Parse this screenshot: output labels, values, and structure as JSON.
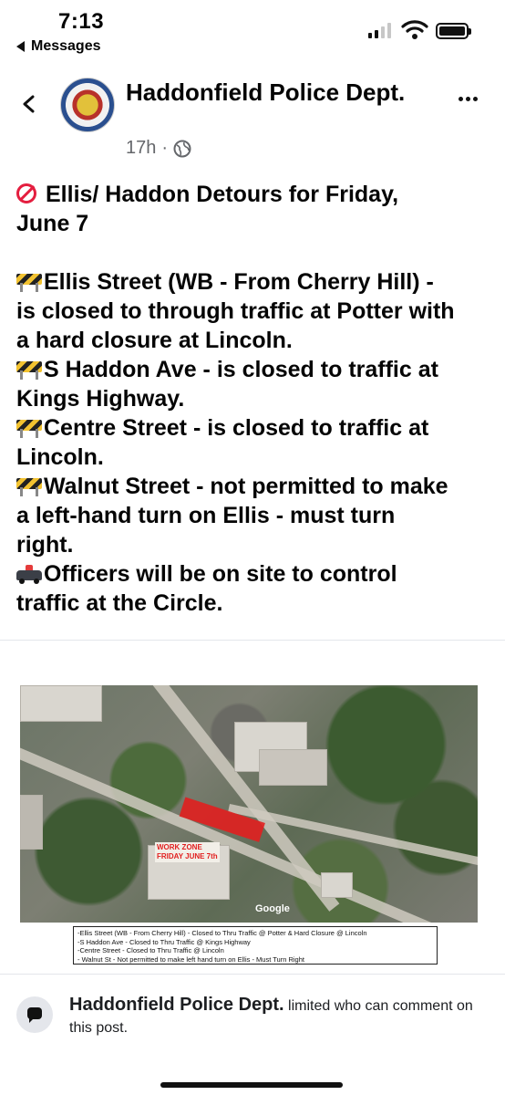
{
  "status_bar": {
    "time": "7:13",
    "back_app": "Messages"
  },
  "header": {
    "page_name": "Haddonfield Police Dept.",
    "timestamp": "17h",
    "separator": "·",
    "audience_icon": "globe-icon",
    "back_icon": "chevron-left-icon",
    "more_icon": "more-dots-icon"
  },
  "post": {
    "lines": [
      {
        "icon": "no-entry-icon",
        "text": "Ellis/ Haddon Detours for Friday,"
      },
      {
        "icon": "",
        "text": "June 7"
      },
      {
        "icon": "construction-barrier-icon",
        "text": "Ellis Street (WB - From Cherry Hill) -"
      },
      {
        "icon": "",
        "text": "is closed to through traffic at Potter with"
      },
      {
        "icon": "",
        "text": "a hard closure at Lincoln."
      },
      {
        "icon": "construction-barrier-icon",
        "text": "S Haddon Ave - is closed to traffic at"
      },
      {
        "icon": "",
        "text": "Kings Highway."
      },
      {
        "icon": "construction-barrier-icon",
        "text": "Centre Street - is closed to traffic at"
      },
      {
        "icon": "",
        "text": "Lincoln."
      },
      {
        "icon": "construction-barrier-icon",
        "text": "Walnut Street - not permitted to make"
      },
      {
        "icon": "",
        "text": "a left-hand turn on Ellis - must turn"
      },
      {
        "icon": "",
        "text": "right."
      },
      {
        "icon": "police-car-icon",
        "text": "Officers will be on site to control"
      },
      {
        "icon": "",
        "text": "traffic at the Circle."
      }
    ]
  },
  "image": {
    "work_zone_label_1": "WORK ZONE",
    "work_zone_label_2": "FRIDAY JUNE 7th",
    "map_credit": "Google",
    "legend": [
      "-Ellis Street (WB - From Cherry Hill) - Closed to Thru Traffic @ Potter & Hard Closure @ Lincoln",
      "-S Haddon Ave - Closed to Thru Traffic @ Kings Highway",
      "-Centre Street - Closed to Thru Traffic @ Lincoln",
      "- Walnut St - Not permitted to make left hand turn on Ellis - Must Turn Right"
    ]
  },
  "footer": {
    "name": "Haddonfield Police Dept.",
    "message": "limited who can comment on this post.",
    "icon": "comment-icon"
  },
  "colors": {
    "text": "#050505",
    "meta": "#65676b",
    "no_entry": "#e41e3f",
    "work_zone": "#e11f1f"
  }
}
